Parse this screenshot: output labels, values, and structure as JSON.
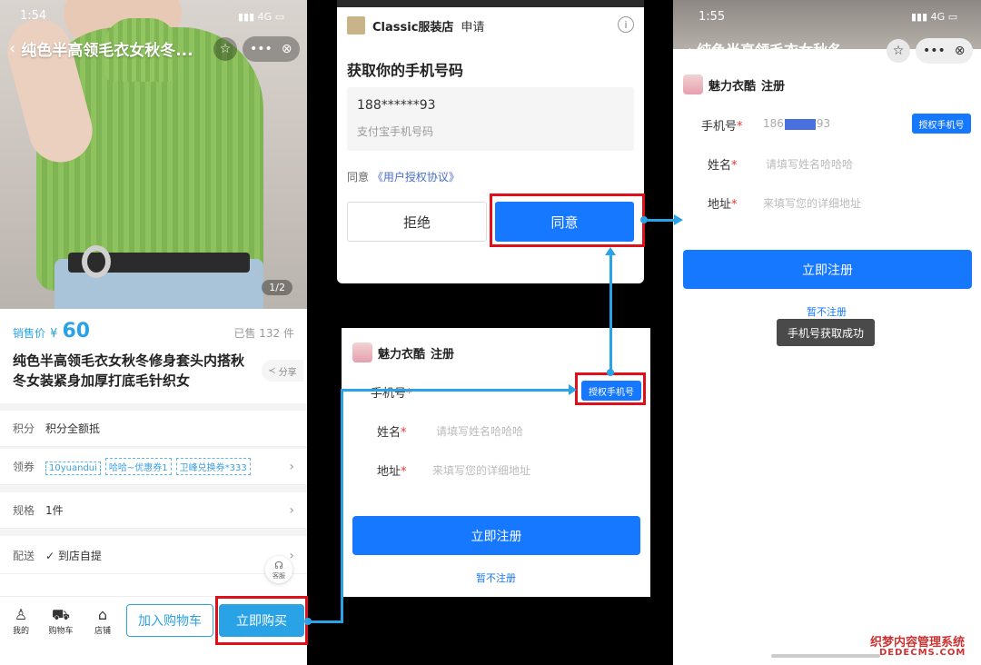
{
  "panel1": {
    "status": {
      "time": "1:54",
      "network": "4G"
    },
    "nav_title": "纯色半高领毛衣女秋冬...",
    "page_indicator": "1/2",
    "price_label": "销售价",
    "currency": "¥",
    "price": "60",
    "sold": "已售 132 件",
    "product_title": "纯色半高领毛衣女秋冬修身套头内搭秋冬女装紧身加厚打底毛针织女",
    "share": "分享",
    "rows": {
      "points_key": "积分",
      "points_val": "积分全额抵",
      "coupon_key": "领券",
      "coupons": [
        "10yuandui",
        "哈哈~优惠券1",
        "卫峰兑换券*333"
      ],
      "spec_key": "规格",
      "spec_val": "1件",
      "delivery_key": "配送",
      "delivery_val": "到店自提"
    },
    "kefu": "客服",
    "tabs": {
      "mine": "我的",
      "cart": "购物车",
      "store": "店铺"
    },
    "add_cart": "加入购物车",
    "buy_now": "立即购买"
  },
  "panel2": {
    "shop_name": "Classic服装店",
    "apply": "申请",
    "heading": "获取你的手机号码",
    "phone": "188******93",
    "phone_desc": "支付宝手机号码",
    "agree_prefix": "同意",
    "agreement": "《用户授权协议》",
    "reject": "拒绝",
    "accept": "同意"
  },
  "panel3": {
    "brand": "魅力衣酷",
    "title": "注册",
    "phone_label": "手机号",
    "auth_button": "授权手机号",
    "name_label": "姓名",
    "name_placeholder": "请填写姓名哈哈哈",
    "address_label": "地址",
    "address_placeholder": "来填写您的详细地址",
    "register": "立即注册",
    "skip": "暂不注册"
  },
  "panel4": {
    "status": {
      "time": "1:55",
      "network": "4G"
    },
    "nav_title": "纯色半高领毛衣女秋冬...",
    "brand": "魅力衣酷",
    "title": "注册",
    "phone_label": "手机号",
    "phone_prefix": "186",
    "phone_suffix": "93",
    "auth_button": "授权手机号",
    "name_label": "姓名",
    "name_placeholder": "请填写姓名哈哈哈",
    "address_label": "地址",
    "address_placeholder": "来填写您的详细地址",
    "register": "立即注册",
    "skip": "暂不注册",
    "toast": "手机号获取成功"
  },
  "watermark": {
    "line1": "织梦内容管理系统",
    "line2": "DEDECMS.COM"
  },
  "colors": {
    "accent": "#2aa3e6",
    "primary": "#1677ff",
    "highlight": "#e0101a"
  }
}
